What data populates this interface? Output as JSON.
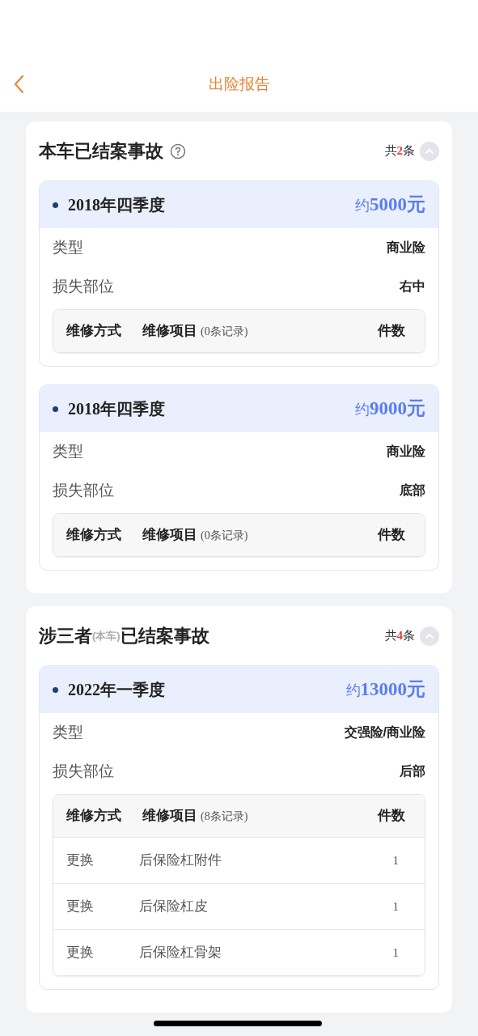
{
  "header": {
    "title": "出险报告"
  },
  "sections": [
    {
      "title_main": "本车已结案事故",
      "help": true,
      "total_prefix": "共",
      "total": "2",
      "total_suffix": "条",
      "expanded": true,
      "accidents": [
        {
          "period": "2018年四季度",
          "amount_prefix": "约",
          "amount": "5000元",
          "fields": [
            {
              "label": "类型",
              "value": "商业险"
            },
            {
              "label": "损失部位",
              "value": "右中"
            }
          ],
          "table": {
            "columns": [
              "维修方式",
              "维修项目",
              "件数"
            ],
            "record_note": "(0条记录)"
          }
        },
        {
          "period": "2018年四季度",
          "amount_prefix": "约",
          "amount": "9000元",
          "fields": [
            {
              "label": "类型",
              "value": "商业险"
            },
            {
              "label": "损失部位",
              "value": "底部"
            }
          ],
          "table": {
            "columns": [
              "维修方式",
              "维修项目",
              "件数"
            ],
            "record_note": "(0条记录)"
          }
        }
      ]
    },
    {
      "title_main": "涉三者",
      "title_note": "(本车)",
      "title_rest": "已结案事故",
      "help": false,
      "total_prefix": "共",
      "total": "4",
      "total_suffix": "条",
      "expanded": true,
      "accidents": [
        {
          "period": "2022年一季度",
          "amount_prefix": "约",
          "amount": "13000元",
          "fields": [
            {
              "label": "类型",
              "value": "交强险/商业险"
            },
            {
              "label": "损失部位",
              "value": "后部"
            }
          ],
          "table": {
            "columns": [
              "维修方式",
              "维修项目",
              "件数"
            ],
            "record_note": "(8条记录)",
            "rows": [
              [
                "更换",
                "后保险杠附件",
                "1"
              ],
              [
                "更换",
                "后保险杠皮",
                "1"
              ],
              [
                "更换",
                "后保险杠骨架",
                "1"
              ]
            ]
          }
        }
      ]
    }
  ]
}
